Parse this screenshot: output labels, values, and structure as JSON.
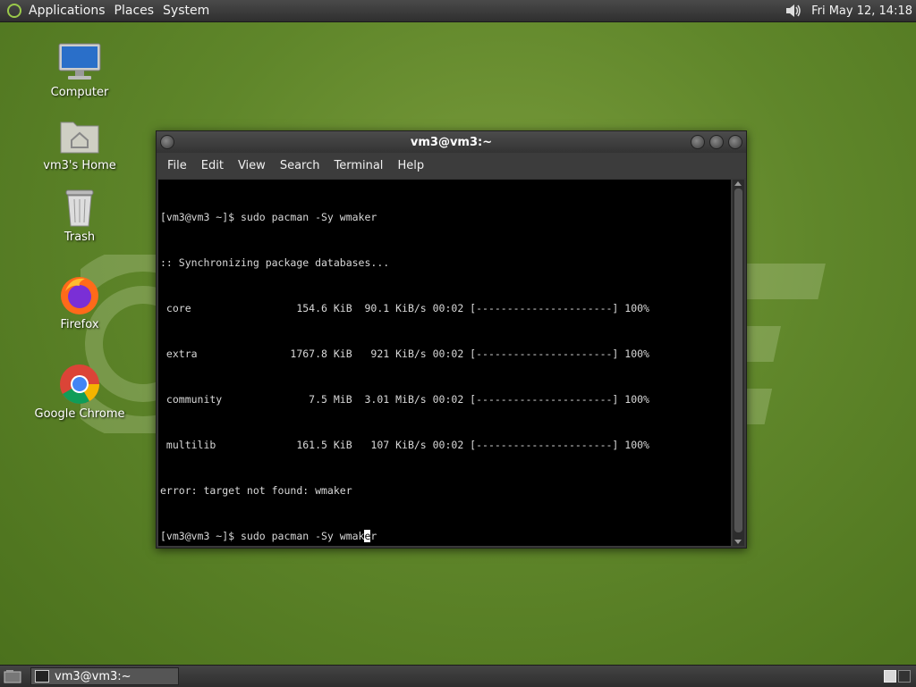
{
  "top_panel": {
    "menus": [
      "Applications",
      "Places",
      "System"
    ],
    "clock": "Fri May 12, 14:18",
    "icons": [
      "menu-logo-icon",
      "volume-icon"
    ]
  },
  "desktop": {
    "icons": [
      {
        "label": "Computer",
        "icon": "computer-icon"
      },
      {
        "label": "vm3's Home",
        "icon": "home-folder-icon"
      },
      {
        "label": "Trash",
        "icon": "trash-icon"
      },
      {
        "label": "Firefox",
        "icon": "firefox-icon"
      },
      {
        "label": "Google Chrome",
        "icon": "chrome-icon"
      }
    ]
  },
  "terminal_window": {
    "title": "vm3@vm3:~",
    "menu": [
      "File",
      "Edit",
      "View",
      "Search",
      "Terminal",
      "Help"
    ],
    "lines": [
      "[vm3@vm3 ~]$ sudo pacman -Sy wmaker",
      ":: Synchronizing package databases...",
      " core                 154.6 KiB  90.1 KiB/s 00:02 [----------------------] 100%",
      " extra               1767.8 KiB   921 KiB/s 00:02 [----------------------] 100%",
      " community              7.5 MiB  3.01 MiB/s 00:02 [----------------------] 100%",
      " multilib             161.5 KiB   107 KiB/s 00:02 [----------------------] 100%",
      "error: target not found: wmaker"
    ],
    "current_prompt_before_cursor": "[vm3@vm3 ~]$ sudo pacman -Sy wmak",
    "cursor_char": "e",
    "current_prompt_after_cursor": "r"
  },
  "bottom_panel": {
    "task_label": "vm3@vm3:~",
    "workspaces": 2,
    "active_workspace": 1
  },
  "colors": {
    "desktop_bg": "#5f862a",
    "panel_bg": "#3a3a3a",
    "terminal_bg": "#000000",
    "terminal_fg": "#d8d8d8"
  }
}
